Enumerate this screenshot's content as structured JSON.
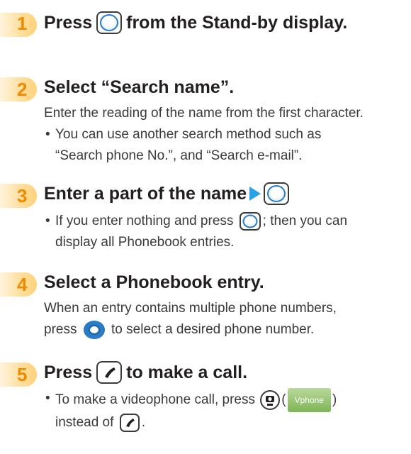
{
  "steps": [
    {
      "number": "1",
      "title_before": "Press",
      "title_key": "nav-key-icon",
      "title_after": "from the Stand-by display."
    },
    {
      "number": "2",
      "title": "Select “Search name”.",
      "body": "Enter the reading of the name from the first character.",
      "bullet_line1": "You can use another search method such as",
      "bullet_line2": "“Search phone No.”, and “Search e-mail”."
    },
    {
      "number": "3",
      "title": "Enter a part of the name",
      "bullet_line1_before": "If you enter nothing and press",
      "bullet_line1_after": "; then you can",
      "bullet_line2": "display all Phonebook entries."
    },
    {
      "number": "4",
      "title": "Select a Phonebook entry.",
      "body_line1": "When an entry contains multiple phone numbers,",
      "body_line2_before": "press",
      "body_line2_after": "to select a desired phone number."
    },
    {
      "number": "5",
      "title_before": "Press",
      "title_after": "to make a call.",
      "bullet_line1_before": "To make a videophone call, press",
      "vphone_label": "Vphone",
      "bullet_line2_before": "instead of",
      "bullet_line2_after": "."
    }
  ],
  "colors": {
    "step_number": "#f08a00",
    "key_ring": "#2a7cc7",
    "arrow": "#29a3e6",
    "vphone_chip": "#7fb458"
  }
}
